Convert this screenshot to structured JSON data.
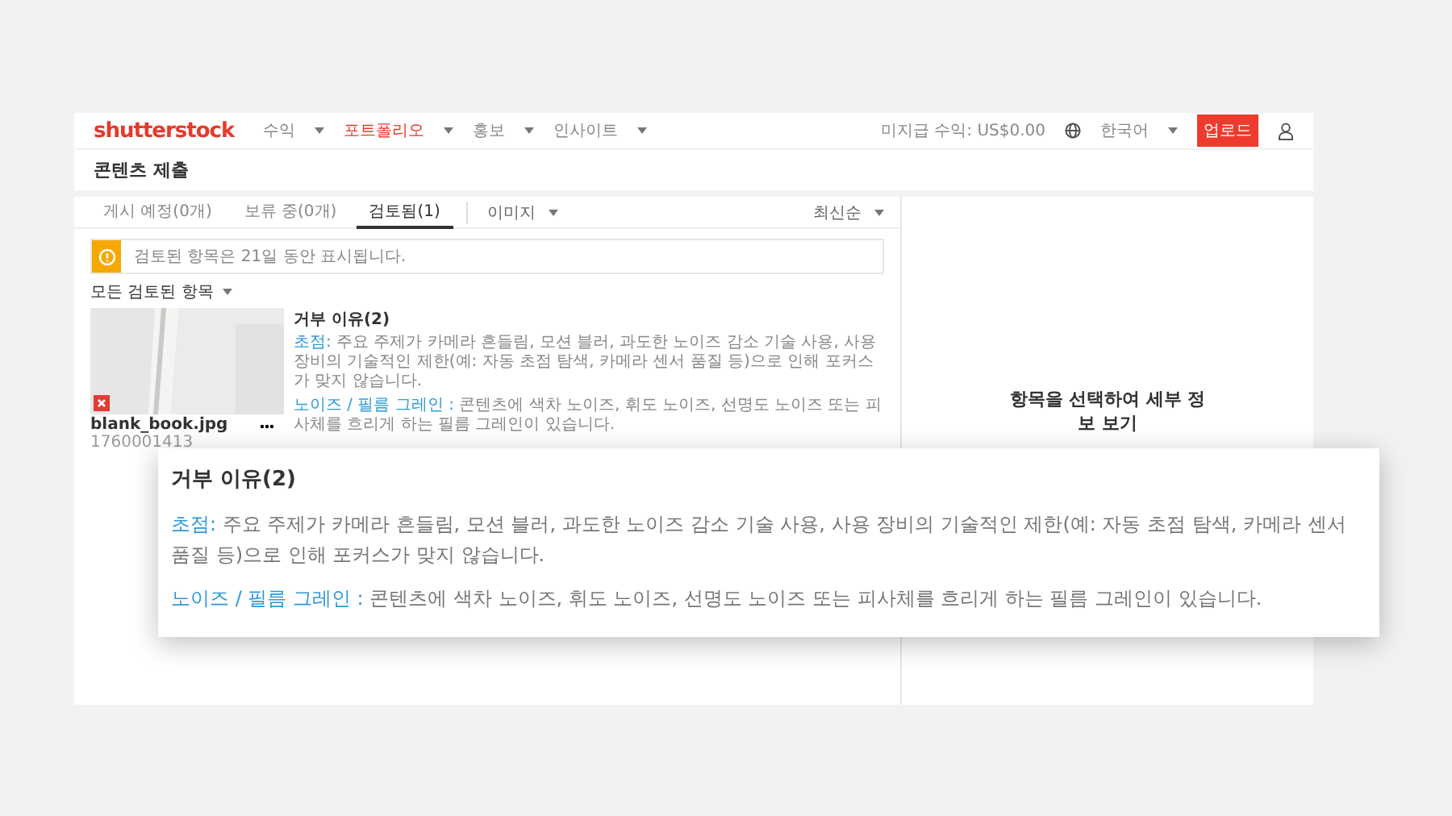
{
  "header": {
    "logo": "shutterstock",
    "nav": [
      {
        "label": "수익",
        "selected": false
      },
      {
        "label": "포트폴리오",
        "selected": true
      },
      {
        "label": "홍보",
        "selected": false
      },
      {
        "label": "인사이트",
        "selected": false
      }
    ],
    "earnings": "미지급 수익: US$0.00",
    "language": "한국어",
    "upload": "업로드"
  },
  "page_title": "콘텐츠 제출",
  "tabs": [
    {
      "label": "게시 예정(0개)",
      "selected": false
    },
    {
      "label": "보류 중(0개)",
      "selected": false
    },
    {
      "label": "검토됨(1)",
      "selected": true
    }
  ],
  "type_filter": "이미지",
  "sort": "최신순",
  "notice": "검토된 항목은 21일 동안 표시됩니다.",
  "item_filter": "모든 검토된 항목",
  "item": {
    "kind": "picture",
    "rejected": true,
    "filename": "blank_book.jpg",
    "id": "1760001413",
    "title": "거부 이유(2)",
    "reasons": [
      {
        "label": "초점:",
        "text": " 주요 주제가 카메라 흔들림, 모션 블러, 과도한 노이즈 감소 기술 사용, 사용 장비의 기술적인 제한(예: 자동 초점 탐색, 카메라 센서 품질 등)으로 인해 포커스가 맞지 않습니다."
      },
      {
        "label": "노이즈 / 필름 그레인 :",
        "text": " 콘텐츠에 색차 노이즈, 휘도 노이즈, 선명도 노이즈 또는 피사체를 흐리게 하는 필름 그레인이 있습니다."
      }
    ]
  },
  "detail_prompt": "항목을 선택하여 세부 정보 보기",
  "callout": {
    "title": "거부 이유(2)",
    "reasons": [
      {
        "label": "초점:",
        "text": " 주요 주제가 카메라 흔들림, 모션 블러, 과도한 노이즈 감소 기술 사용, 사용 장비의 기술적인 제한(예: 자동 초점 탐색, 카메라 센서 품질 등)으로 인해 포커스가 맞지 않습니다."
      },
      {
        "label": "노이즈 / 필름 그레인 :",
        "text": " 콘텐츠에 색차 노이즈, 휘도 노이즈, 선명도 노이즈 또는 피사체를 흐리게 하는 필름 그레인이 있습니다."
      }
    ]
  }
}
